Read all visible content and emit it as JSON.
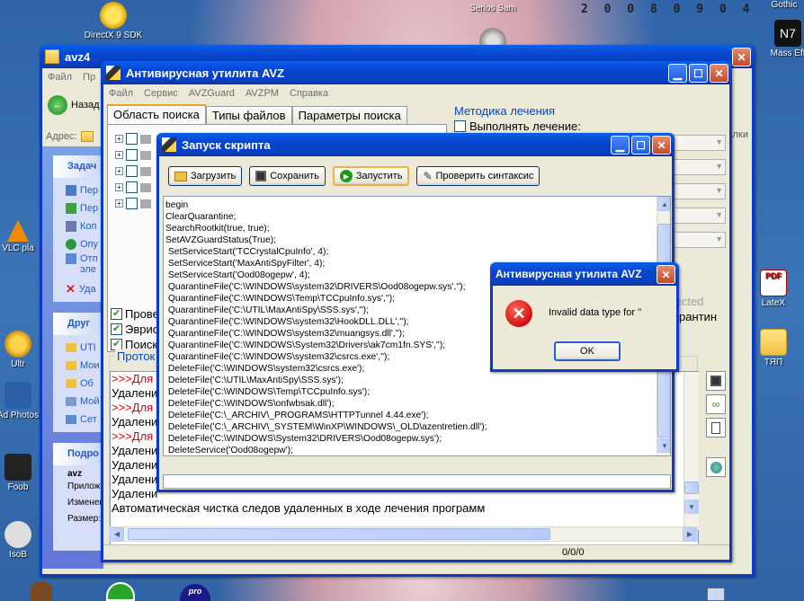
{
  "desktop": {
    "date": "2 0 0 8 0 9 0 4",
    "icons": [
      {
        "label": "DirectX 9 SDK"
      },
      {
        "label": "Serios Sam"
      },
      {
        "label": "Gothic"
      },
      {
        "label": "Mass Eff"
      },
      {
        "label": "VLC pla"
      },
      {
        "label": "Ultr"
      },
      {
        "label": "Ad Photos"
      },
      {
        "label": "Foob"
      },
      {
        "label": "IsoB"
      },
      {
        "label": "LateX"
      },
      {
        "label": "ТЯП"
      }
    ]
  },
  "explorer": {
    "title": "avz4",
    "menu": [
      "Файл",
      "Пр"
    ],
    "back_label": "Назад",
    "address_label": "Адрес:",
    "tasks_header": "Задач",
    "task_items": [
      "Пер",
      "Пер",
      "Коп",
      "Опу",
      "Отп эле",
      "Уда"
    ],
    "other_header": "Друг",
    "other_items": [
      "UTI",
      "Мои",
      "Об",
      "Мой",
      "Сет"
    ],
    "details_header": "Подро",
    "details_name": "avz",
    "details_lines": [
      "Прилож",
      "Изменен",
      "Размер:"
    ],
    "right_text": "алки"
  },
  "avz": {
    "title": "Антивирусная утилита AVZ",
    "menu": [
      "Файл",
      "Сервис",
      "AVZGuard",
      "AVZPM",
      "Справка"
    ],
    "tabs": [
      "Область поиска",
      "Типы файлов",
      "Параметры поиска"
    ],
    "method_header": "Методика лечения",
    "method_option": "Выполнять лечение:",
    "options": [
      "Прове",
      "Эврис",
      "Поиск"
    ],
    "infected_label": "fected",
    "quarantine_label": "рантин",
    "protocol_header": "Проток",
    "protocol_lines": [
      ">>>Для у",
      "Удалени",
      ">>>Для у",
      "Удалени",
      ">>>Для у",
      "Удалени",
      "Удалени",
      "Удалени",
      "Удалени",
      "Автоматическая чистка следов удаленных в ходе лечения программ"
    ],
    "status": "0/0/0"
  },
  "script": {
    "title": "Запуск скрипта",
    "buttons": {
      "load": "Загрузить",
      "save": "Сохранить",
      "run": "Запустить",
      "check": "Проверить синтаксис"
    },
    "lines": [
      "begin",
      "ClearQuarantine;",
      "SearchRootkit(true, true);",
      "SetAVZGuardStatus(True);",
      " SetServiceStart('TCCrystalCpuInfo', 4);",
      " SetServiceStart('MaxAntiSpyFilter', 4);",
      " SetServiceStart('Ood08ogepw', 4);",
      " QuarantineFile('C:\\WINDOWS\\system32\\DRIVERS\\Ood08ogepw.sys','');",
      " QuarantineFile('C:\\WINDOWS\\Temp\\TCCpuInfo.sys','');",
      " QuarantineFile('C:\\UTIL\\MaxAntiSpy\\SSS.sys','');",
      " QuarantineFile('C:\\WINDOWS\\system32\\HookDLL.DLL','');",
      " QuarantineFile('C:\\WINDOWS\\system32\\muangsys.dll','');",
      " QuarantineFile('C:\\WINDOWS\\System32\\Drivers\\ak7cm1fn.SYS','');",
      " QuarantineFile('C:\\WINDOWS\\system32\\csrcs.exe','');",
      " DeleteFile('C:\\WINDOWS\\system32\\csrcs.exe');",
      " DeleteFile('C:\\UTIL\\MaxAntiSpy\\SSS.sys');",
      " DeleteFile('C:\\WINDOWS\\Temp\\TCCpuInfo.sys');",
      " DeleteFile('C:\\WINDOWS\\onfwbsak.dll');",
      " DeleteFile('C:\\_ARCHIV\\_PROGRAMS\\HTTPTunnel 4.44.exe');",
      " DeleteFile('C:\\_ARCHIV\\_SYSTEM\\WinXP\\WINDOWS\\_OLD\\azentretien.dll');",
      " DeleteFile('C:\\WINDOWS\\System32\\DRIVERS\\Ood08ogepw.sys');",
      " DeleteService('Ood08ogepw');"
    ]
  },
  "dialog": {
    "title": "Антивирусная утилита AVZ",
    "message": "Invalid data type for ''",
    "ok_label": "OK"
  }
}
